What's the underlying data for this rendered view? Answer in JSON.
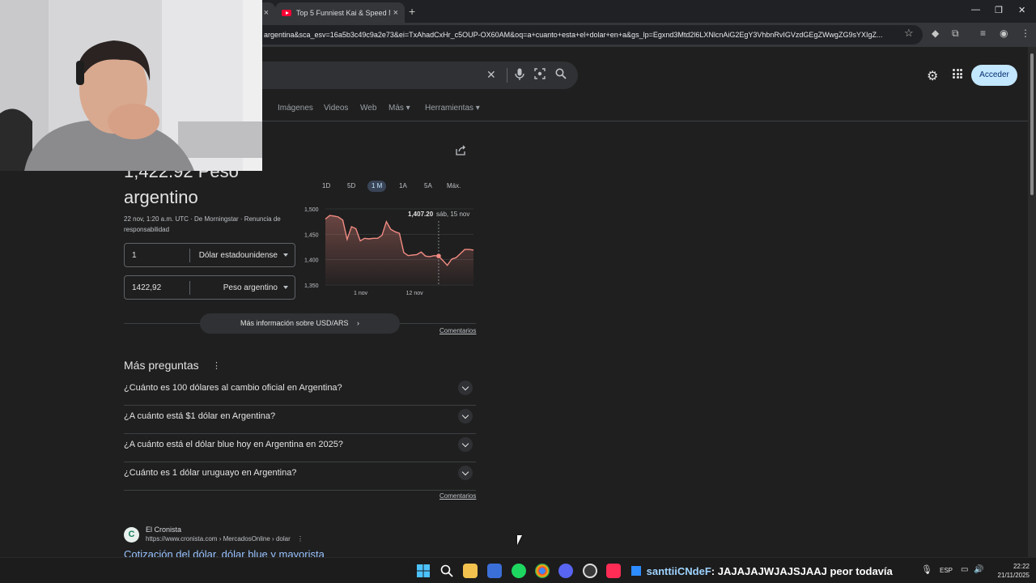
{
  "browser": {
    "tab_left_close": "×",
    "active_tab_title": "Top 5 Funniest Kai & Speed Mo",
    "active_tab_close": "×",
    "new_tab": "+",
    "url": "argentina&sca_esv=16a5b3c49c9a2e73&ei=TxAhadCxHr_c5OUP-OX60AM&oq=a+cuanto+esta+el+dolar+en+a&gs_lp=Egxnd3Mtd2l6LXNlcnAiG2EgY3VhbnRvIGVzdGEgZWwgZG9sYXIgZ..."
  },
  "google": {
    "sign_in": "Acceder",
    "filters": [
      "s",
      "Imágenes",
      "Videos",
      "Web",
      "Más ▾",
      "Herramientas ▾"
    ]
  },
  "converter": {
    "result_line1": "1,422.92 Peso",
    "result_line2": "argentino",
    "meta": "22 nov, 1:20 a.m. UTC · De Morningstar · Renuncia de responsabilidad",
    "from_value": "1",
    "from_currency": "Dólar estadounidense",
    "to_value": "1422,92",
    "to_currency": "Peso argentino",
    "ranges": [
      "1D",
      "5D",
      "1 M",
      "1A",
      "5A",
      "Máx."
    ],
    "active_range": "1 M",
    "tooltip_value": "1,407.20",
    "tooltip_date": "sáb, 15 nov",
    "more_info": "Más información sobre USD/ARS",
    "feedback": "Comentarios"
  },
  "chart_data": {
    "type": "line",
    "series": [
      {
        "values": [
          1480,
          1487,
          1486,
          1484,
          1478,
          1440,
          1465,
          1461,
          1437,
          1442,
          1441,
          1442,
          1442,
          1448,
          1475,
          1460,
          1455,
          1452,
          1414,
          1408,
          1409,
          1410,
          1415,
          1407,
          1406,
          1408,
          1407.2,
          1398,
          1389,
          1401,
          1404,
          1412,
          1420,
          1420,
          1419
        ]
      }
    ],
    "x_tick_labels": [
      "1 nov",
      "12 nov"
    ],
    "y_tick_labels": [
      "1,500",
      "1,450",
      "1,400",
      "1,350"
    ],
    "ylim": [
      1350,
      1500
    ],
    "highlight_index": 26,
    "color": "#f28b82",
    "grid": true
  },
  "people_also_ask": {
    "title": "Más preguntas",
    "questions": [
      "¿Cuánto es 100 dólares al cambio oficial en Argentina?",
      "¿A cuánto está $1 dólar en Argentina?",
      "¿A cuánto está el dólar blue hoy en Argentina en 2025?",
      "¿Cuánto es 1 dólar uruguayo en Argentina?"
    ],
    "feedback": "Comentarios"
  },
  "result": {
    "site_name": "El Cronista",
    "site_url": "https://www.cronista.com › MercadosOnline › dolar",
    "title": "Cotización del dólar, dólar blue y mayorista"
  },
  "taskbar": {
    "chat_user": "santtiiCNdeF",
    "chat_message": ": JAJAJAJWJAJSJAAJ peor todavía",
    "lang": "ESP",
    "time": "22:22",
    "date": "21/11/2025"
  }
}
